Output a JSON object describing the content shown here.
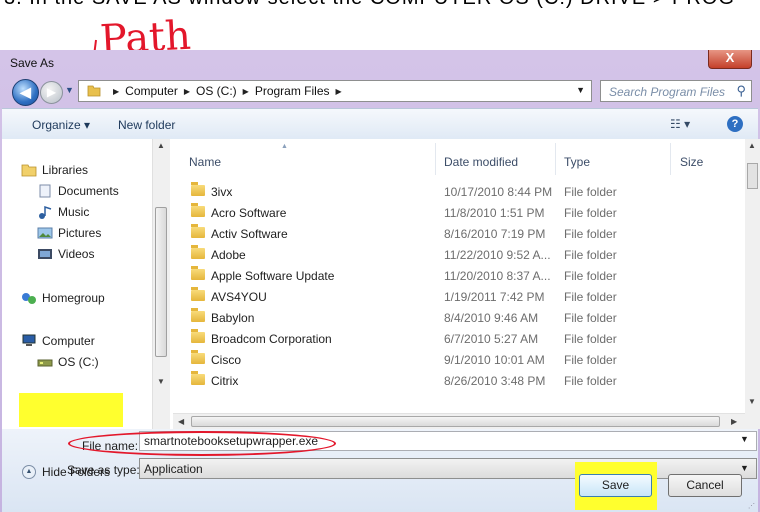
{
  "instruction": {
    "visible_text": "3. In the SAVE AS window select the COMPUTER OS (C:) DRIVE > PROG",
    "annotation": "Path"
  },
  "window": {
    "title": "Save As",
    "close_label": "X"
  },
  "address_bar": {
    "crumbs": [
      "Computer",
      "OS (C:)",
      "Program Files"
    ]
  },
  "search": {
    "placeholder": "Search Program Files"
  },
  "toolbar": {
    "organize": "Organize ▾",
    "new_folder": "New folder"
  },
  "nav_pane": {
    "libraries": "Libraries",
    "documents": "Documents",
    "music": "Music",
    "pictures": "Pictures",
    "videos": "Videos",
    "homegroup": "Homegroup",
    "computer": "Computer",
    "os_drive": "OS (C:)"
  },
  "columns": {
    "name": "Name",
    "date": "Date modified",
    "type": "Type",
    "size": "Size"
  },
  "files": [
    {
      "name": "3ivx",
      "date": "10/17/2010 8:44 PM",
      "type": "File folder"
    },
    {
      "name": "Acro Software",
      "date": "11/8/2010 1:51 PM",
      "type": "File folder"
    },
    {
      "name": "Activ Software",
      "date": "8/16/2010 7:19 PM",
      "type": "File folder"
    },
    {
      "name": "Adobe",
      "date": "11/22/2010 9:52 A...",
      "type": "File folder"
    },
    {
      "name": "Apple Software Update",
      "date": "11/20/2010 8:37 A...",
      "type": "File folder"
    },
    {
      "name": "AVS4YOU",
      "date": "1/19/2011 7:42 PM",
      "type": "File folder"
    },
    {
      "name": "Babylon",
      "date": "8/4/2010 9:46 AM",
      "type": "File folder"
    },
    {
      "name": "Broadcom Corporation",
      "date": "6/7/2010 5:27 AM",
      "type": "File folder"
    },
    {
      "name": "Cisco",
      "date": "9/1/2010 10:01 AM",
      "type": "File folder"
    },
    {
      "name": "Citrix",
      "date": "8/26/2010 3:48 PM",
      "type": "File folder"
    }
  ],
  "form": {
    "file_name_label": "File name:",
    "file_name_value": "smartnotebooksetupwrapper.exe",
    "save_type_label": "Save as type:",
    "save_type_value": "Application"
  },
  "footer": {
    "hide_folders": "Hide Folders",
    "save": "Save",
    "cancel": "Cancel"
  },
  "colors": {
    "annotation_red": "#e3172b",
    "highlight_yellow": "#ffff2e"
  }
}
